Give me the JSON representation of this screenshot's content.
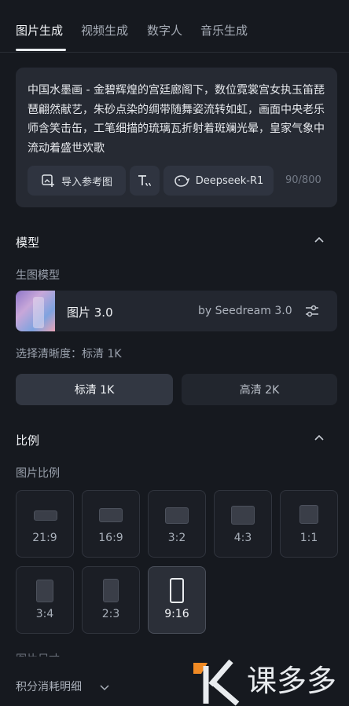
{
  "tabs": [
    {
      "label": "图片生成",
      "active": true
    },
    {
      "label": "视频生成",
      "active": false
    },
    {
      "label": "数字人",
      "active": false
    },
    {
      "label": "音乐生成",
      "active": false
    }
  ],
  "prompt": {
    "text": "中国水墨画 - 金碧辉煌的宫廷廊阁下，数位霓裳宫女执玉笛琵琶翩然献艺，朱砂点染的绸带随舞姿流转如虹，画面中央老乐师含笑击缶，工笔细描的琉璃瓦折射着斑斓光晕，皇家气象中流动着盛世欢歌",
    "upload_ref_label": "导入参考图",
    "model_chip_label": "Deepseek-R1",
    "counter": "90/800"
  },
  "model_section": {
    "title": "模型",
    "sub_label": "生图模型",
    "model_name": "图片 3.0",
    "model_by": "by Seedream 3.0"
  },
  "quality": {
    "label": "选择清晰度：标清 1K",
    "options": [
      {
        "label": "标清 1K",
        "selected": true
      },
      {
        "label": "高清 2K",
        "selected": false
      }
    ]
  },
  "ratio_section": {
    "title": "比例",
    "sub_label": "图片比例",
    "options": [
      {
        "label": "21:9",
        "selected": false
      },
      {
        "label": "16:9",
        "selected": false
      },
      {
        "label": "3:2",
        "selected": false
      },
      {
        "label": "4:3",
        "selected": false
      },
      {
        "label": "1:1",
        "selected": false
      },
      {
        "label": "3:4",
        "selected": false
      },
      {
        "label": "2:3",
        "selected": false
      },
      {
        "label": "9:16",
        "selected": true
      }
    ]
  },
  "next_section_partial": "图片尺寸",
  "footer": {
    "cost_label": "积分消耗明细"
  },
  "watermark_text": "课多多",
  "colors": {
    "background": "#16191f",
    "card": "#262a33",
    "accent_orange": "#f08a24"
  }
}
